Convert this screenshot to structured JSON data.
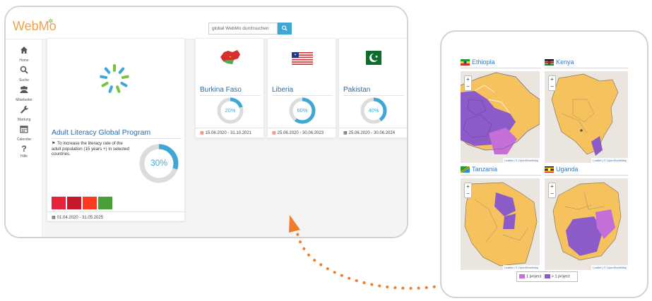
{
  "app": {
    "logo": "WebMo",
    "logo_mark": "✲"
  },
  "search": {
    "placeholder": "global WebMo durchsuchen",
    "button_icon": "search-icon"
  },
  "sidebar": {
    "items": [
      {
        "label": "Home",
        "icon": "home-icon"
      },
      {
        "label": "Suche",
        "icon": "search-icon"
      },
      {
        "label": "Mitarbeiter",
        "icon": "users-icon"
      },
      {
        "label": "Wartung",
        "icon": "wrench-icon"
      },
      {
        "label": "Calendar",
        "icon": "calendar-icon"
      },
      {
        "label": "Hilfe",
        "icon": "help-icon"
      }
    ]
  },
  "program": {
    "title": "Adult Literacy Global Program",
    "description": "To increase the literacy rate of the adult population (15 years +) in selected countries.",
    "progress": "30%",
    "progress_value": 0.3,
    "date": "01.04.2020 - 31.05.2025",
    "sdg_colors": [
      "#e5243b",
      "#c5192d",
      "#ff3a21",
      "#4c9f38"
    ]
  },
  "countries": [
    {
      "name": "Burkina Faso",
      "progress": "20%",
      "progress_value": 0.2,
      "date": "15.06.2020 - 31.10.2021",
      "flag": "burkina-faso-flag"
    },
    {
      "name": "Liberia",
      "progress": "60%",
      "progress_value": 0.6,
      "date": "25.06.2020 - 30.06.2023",
      "flag": "liberia-flag"
    },
    {
      "name": "Pakistan",
      "progress": "40%",
      "progress_value": 0.4,
      "date": "25.06.2020 - 30.06.2024",
      "flag": "pakistan-flag"
    }
  ],
  "maps": [
    {
      "name": "Ethiopia",
      "attribution": "Leaflet | © OpenStreetMap"
    },
    {
      "name": "Kenya",
      "attribution": "Leaflet | © OpenStreetMap"
    },
    {
      "name": "Tanzania",
      "attribution": "Leaflet | © OpenStreetMap"
    },
    {
      "name": "Uganda",
      "attribution": "Leaflet | © OpenStreetMap"
    }
  ],
  "zoom": {
    "in": "+",
    "out": "−"
  },
  "legend": [
    {
      "label": "1 project",
      "color": "#c46fd8"
    },
    {
      "label": "> 1 project",
      "color": "#8b5cc8"
    }
  ],
  "colors": {
    "accent": "#3fa7d6",
    "arrow": "#ef7d2c",
    "region": "#f5c25e",
    "single": "#c46fd8",
    "multi": "#8b5cc8"
  }
}
